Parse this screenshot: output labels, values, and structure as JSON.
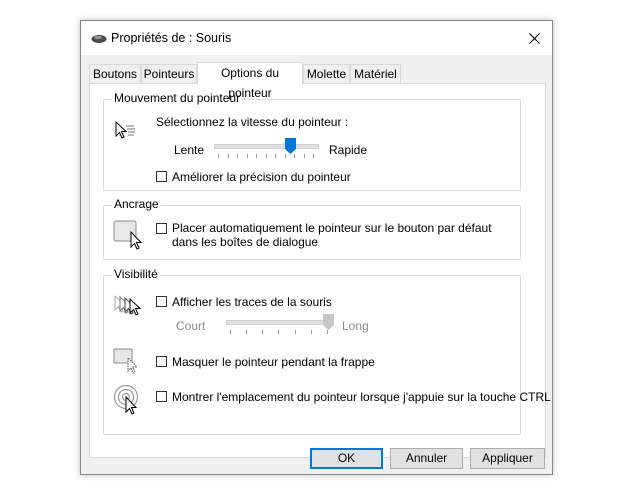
{
  "window": {
    "title": "Propriétés de : Souris"
  },
  "tabs": [
    {
      "label": "Boutons"
    },
    {
      "label": "Pointeurs"
    },
    {
      "label": "Options du pointeur"
    },
    {
      "label": "Molette"
    },
    {
      "label": "Matériel"
    }
  ],
  "active_tab": "Options du pointeur",
  "motion": {
    "group_title": "Mouvement du pointeur",
    "speed_label": "Sélectionnez la vitesse du pointeur :",
    "slow_label": "Lente",
    "fast_label": "Rapide",
    "speed_fraction": 0.76,
    "precision_label": "Améliorer la précision du pointeur",
    "precision_checked": false
  },
  "snap": {
    "group_title": "Ancrage",
    "snap_label": "Placer automatiquement le pointeur sur le bouton par défaut dans les boîtes de dialogue",
    "snap_checked": false
  },
  "visibility": {
    "group_title": "Visibilité",
    "trails_label": "Afficher les traces de la souris",
    "trails_checked": false,
    "short_label": "Court",
    "long_label": "Long",
    "trails_fraction": 1.0,
    "hide_label": "Masquer le pointeur pendant la frappe",
    "hide_checked": false,
    "show_location_label": "Montrer l'emplacement du pointeur lorsque j'appuie sur la touche CTRL",
    "show_location_checked": false
  },
  "buttons": {
    "ok": "OK",
    "cancel": "Annuler",
    "apply": "Appliquer"
  },
  "icons": {
    "title": "mouse-icon",
    "close": "close-icon",
    "speed": "pointer-speed-icon",
    "snap": "snap-to-icon",
    "trails": "pointer-trails-icon",
    "hide": "hide-pointer-icon",
    "location": "pointer-location-icon"
  },
  "colors": {
    "default_button_border": "#0078d7",
    "slider_thumb": "#0078d7",
    "disabled_text": "#8c8c8c"
  }
}
